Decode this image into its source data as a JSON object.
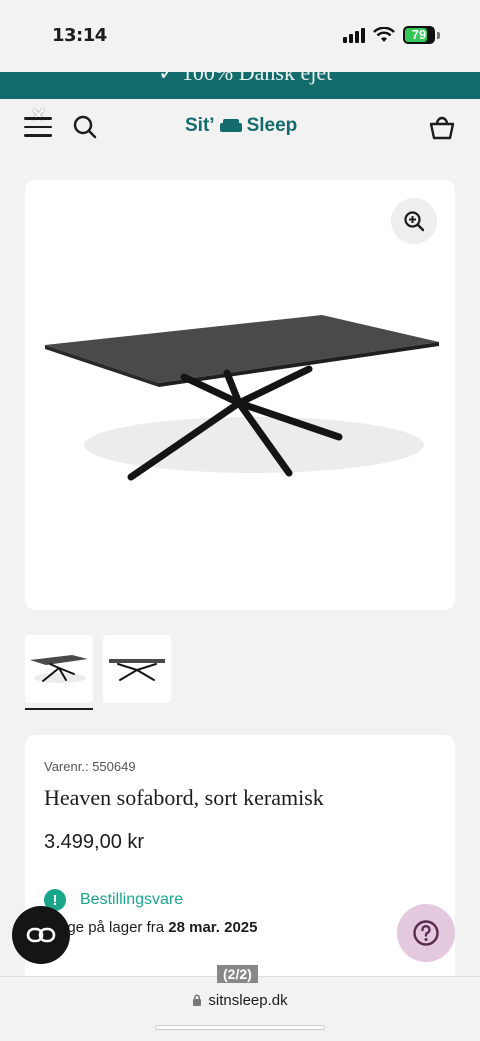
{
  "status_bar": {
    "time": "13:14",
    "battery": "79"
  },
  "promo": {
    "text": "✓ 100% Dansk ejet"
  },
  "header": {
    "logo_text_left": "Sit’",
    "logo_text_right": "Sleep"
  },
  "product": {
    "sku_label": "Varenr.:",
    "sku": "550649",
    "title": "Heaven sofabord, sort keramisk",
    "price": "3.499,00 kr",
    "availability_status": "Bestillingsvare",
    "delivery_prefix": "…age på lager fra",
    "delivery_date": "28 mar. 2025"
  },
  "gallery": {
    "page_indicator": "(2/2)"
  },
  "browser": {
    "url": "sitnsleep.dk"
  },
  "colors": {
    "brand": "#136c6b",
    "accent_green": "#1aa68a",
    "help_bg": "#e3c8de"
  }
}
